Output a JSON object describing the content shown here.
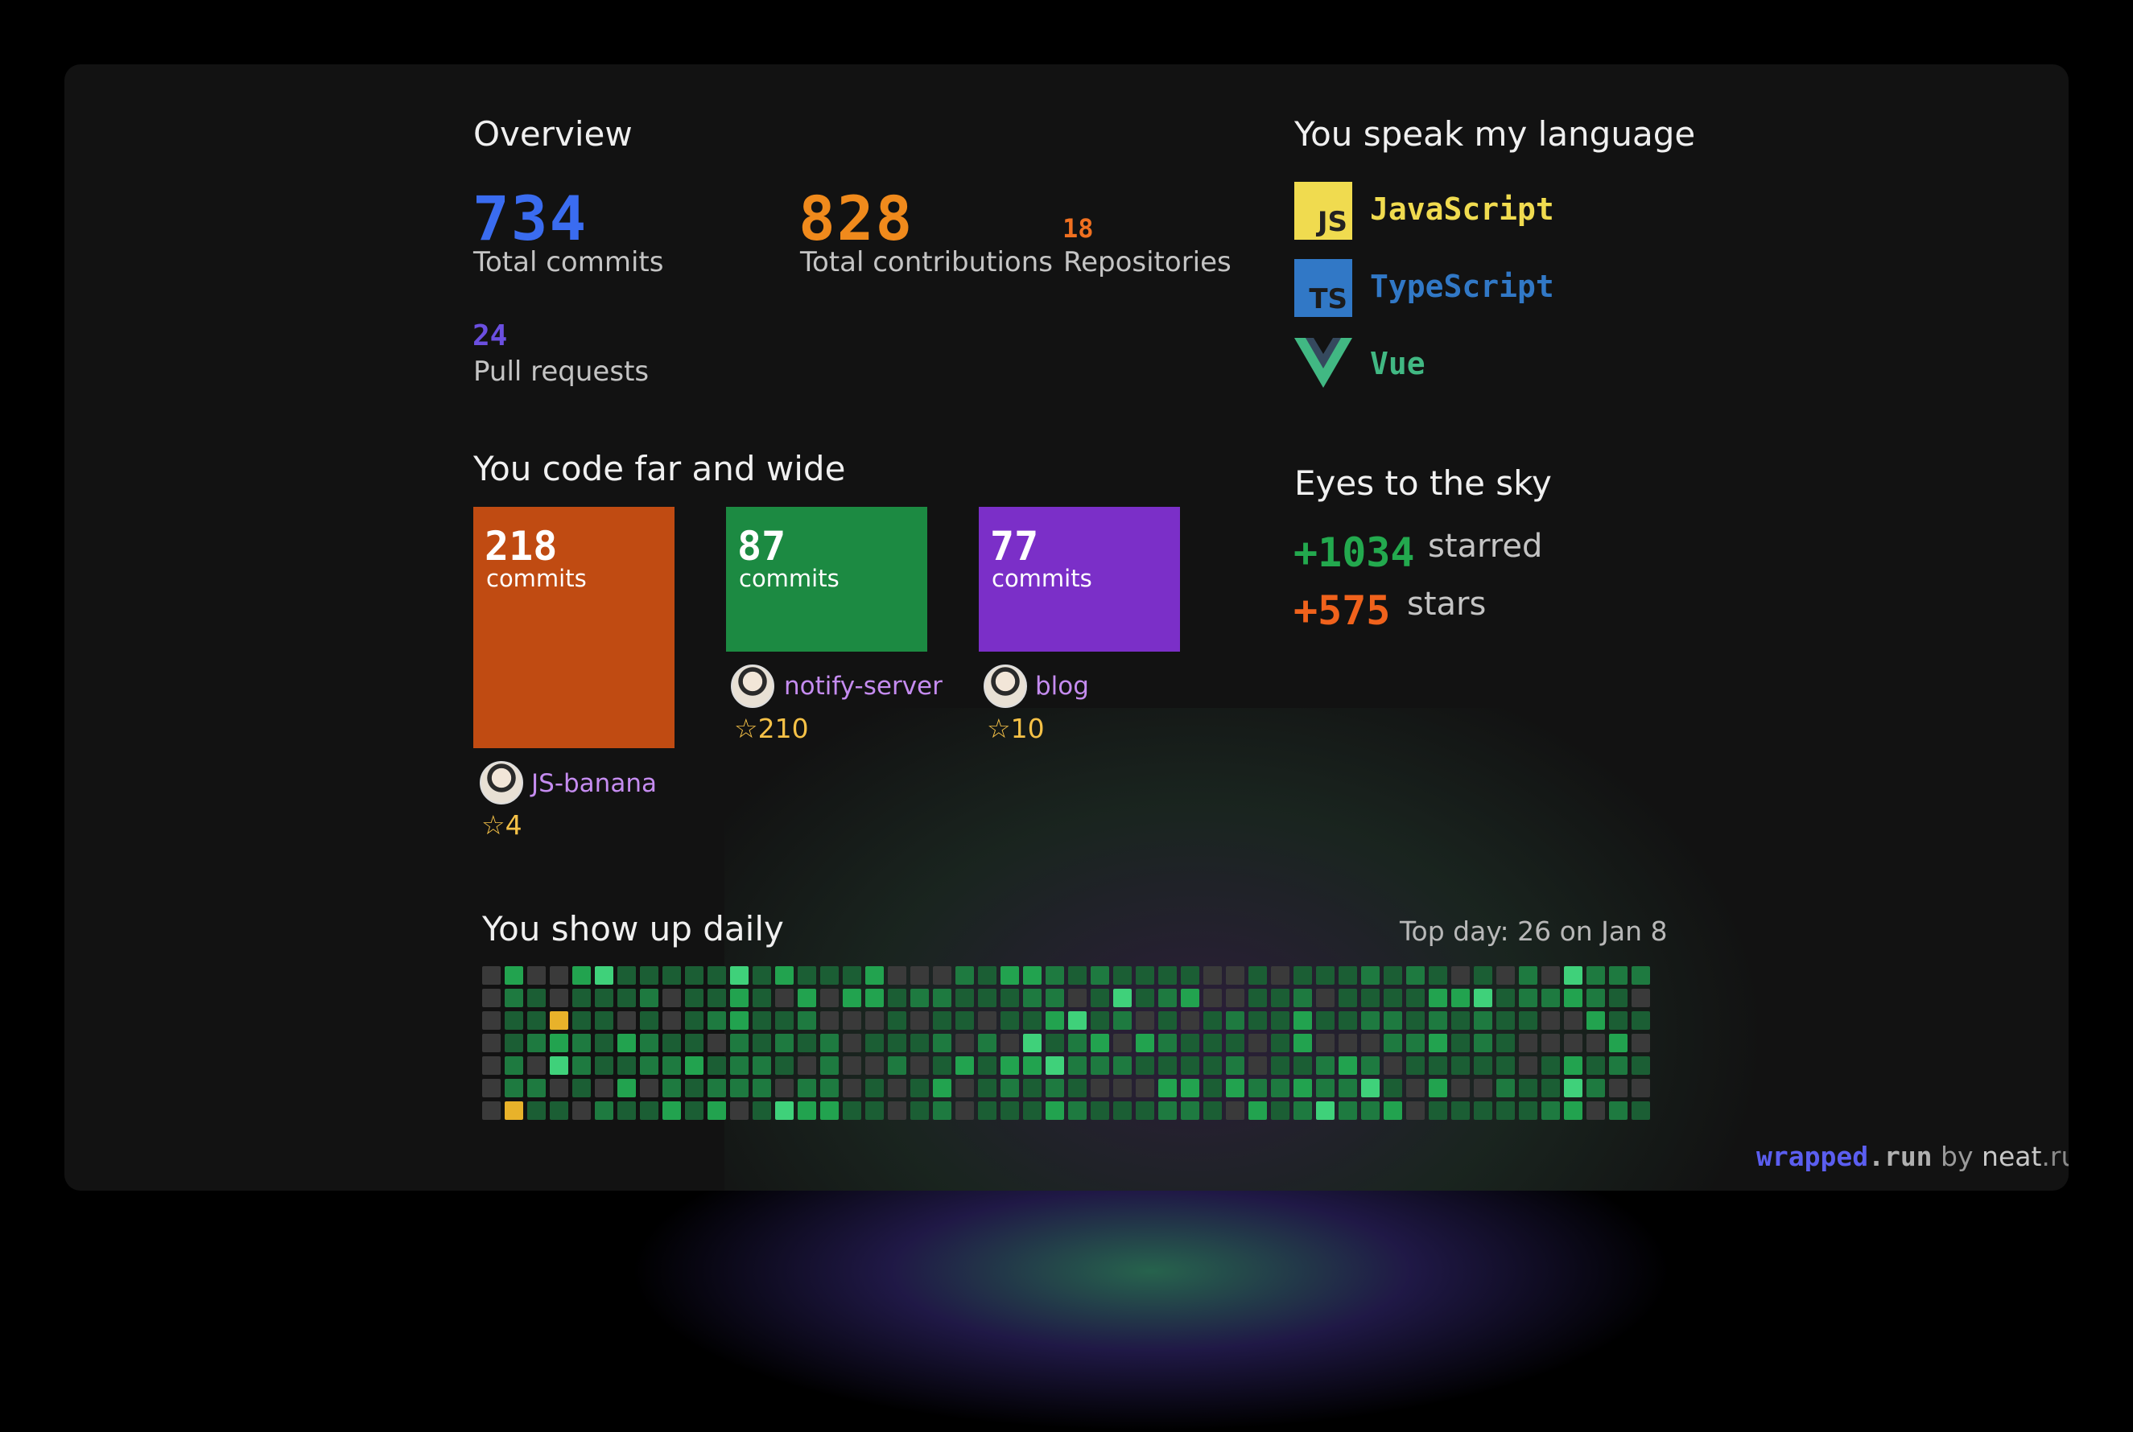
{
  "overview": {
    "title": "Overview",
    "total_commits": {
      "value": "734",
      "label": "Total commits",
      "color": "#3a6cf0"
    },
    "total_contributions": {
      "value": "828",
      "label": "Total contributions",
      "color": "#f08a1c"
    },
    "repositories": {
      "value": "18",
      "label": "Repositories",
      "color": "#f07020"
    },
    "pull_requests": {
      "value": "24",
      "label": "Pull requests",
      "color": "#6b4fe0"
    }
  },
  "languages": {
    "title": "You speak my language",
    "items": [
      {
        "name": "JavaScript",
        "icon": "javascript-icon",
        "badge": "JS",
        "color": "#f0db4f"
      },
      {
        "name": "TypeScript",
        "icon": "typescript-icon",
        "badge": "TS",
        "color": "#3178c6"
      },
      {
        "name": "Vue",
        "icon": "vue-icon",
        "badge": "",
        "color": "#41b883"
      }
    ]
  },
  "repos": {
    "title": "You code far and wide",
    "items": [
      {
        "commits": "218",
        "unit": "commits",
        "name": "JS-banana",
        "stars": "☆4",
        "color": "#c04b12"
      },
      {
        "commits": "87",
        "unit": "commits",
        "name": "notify-server",
        "stars": "☆210",
        "color": "#1c8a42"
      },
      {
        "commits": "77",
        "unit": "commits",
        "name": "blog",
        "stars": "☆10",
        "color": "#7b2fc8"
      }
    ]
  },
  "sky": {
    "title": "Eyes to the sky",
    "starred": {
      "value": "+1034",
      "label": "starred",
      "color": "#23a94e"
    },
    "stars": {
      "value": "+575",
      "label": "stars",
      "color": "#f0621c"
    }
  },
  "daily": {
    "title": "You show up daily",
    "top_day": "Top day: 26 on Jan 8",
    "weeks": 52,
    "days": 7
  },
  "footer": {
    "brand": "wrapped",
    "brand_tld": ".run",
    "by": " by ",
    "author": "neat",
    "author_tld": ".run"
  }
}
